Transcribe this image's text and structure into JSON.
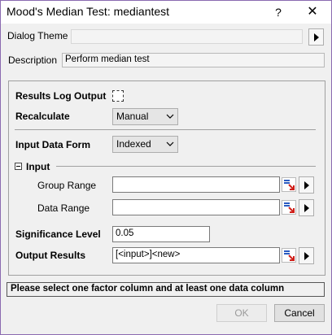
{
  "window": {
    "title": "Mood's Median Test: mediantest",
    "help_glyph": "?",
    "close_glyph": "✕"
  },
  "dialog_theme": {
    "label": "Dialog Theme",
    "value": ""
  },
  "description": {
    "label": "Description",
    "value": "Perform median test"
  },
  "options": {
    "results_log_label": "Results Log Output",
    "results_log_checked": false,
    "recalculate_label": "Recalculate",
    "recalculate_value": "Manual",
    "input_form_label": "Input Data Form",
    "input_form_value": "Indexed"
  },
  "input_group": {
    "label": "Input",
    "group_range_label": "Group Range",
    "group_range_value": "",
    "data_range_label": "Data Range",
    "data_range_value": ""
  },
  "significance": {
    "label": "Significance Level",
    "value": "0.05"
  },
  "output": {
    "label": "Output Results",
    "value": "[<input>]<new>"
  },
  "status_message": "Please select one factor column and at least one data column",
  "buttons": {
    "ok": "OK",
    "cancel": "Cancel"
  }
}
